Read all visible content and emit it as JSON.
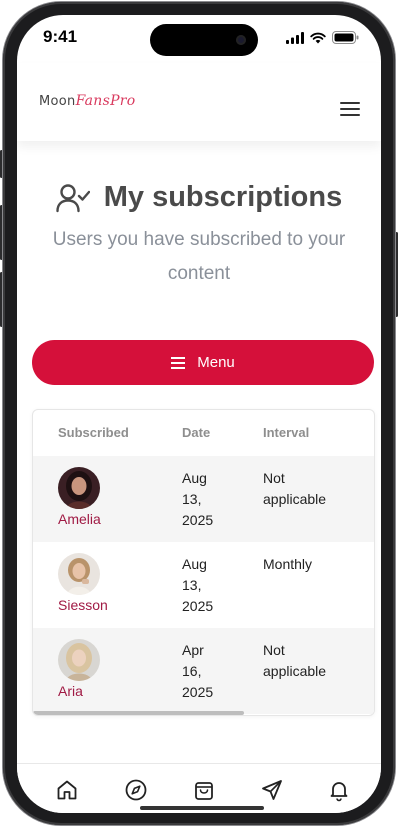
{
  "status_bar": {
    "time": "9:41"
  },
  "header": {
    "logo_prefix": "Moon",
    "logo_script": "FansPro",
    "menu_icon": "hamburger-icon"
  },
  "page": {
    "title": "My subscriptions",
    "title_icon": "user-check-icon",
    "subtitle": "Users you have subscribed to your content"
  },
  "menu_button": {
    "label": "Menu",
    "icon": "hamburger-icon"
  },
  "table": {
    "columns": [
      "Subscribed",
      "Date",
      "Interval"
    ],
    "rows": [
      {
        "name": "Amelia",
        "date_line1": "Aug",
        "date_line2": "13,",
        "date_line3": "2025",
        "interval_line1": "Not",
        "interval_line2": "applicable"
      },
      {
        "name": "Siesson",
        "date_line1": "Aug",
        "date_line2": "13,",
        "date_line3": "2025",
        "interval_line1": "Monthly",
        "interval_line2": ""
      },
      {
        "name": "Aria",
        "date_line1": "Apr",
        "date_line2": "16,",
        "date_line3": "2025",
        "interval_line1": "Not",
        "interval_line2": "applicable"
      }
    ]
  },
  "bottom_nav": [
    "home-icon",
    "compass-icon",
    "shopping-bag-icon",
    "send-icon",
    "bell-icon"
  ],
  "colors": {
    "accent": "#d5103a",
    "username": "#a01a44",
    "logo_script": "#d93a5e",
    "muted_text": "#8a9099"
  }
}
